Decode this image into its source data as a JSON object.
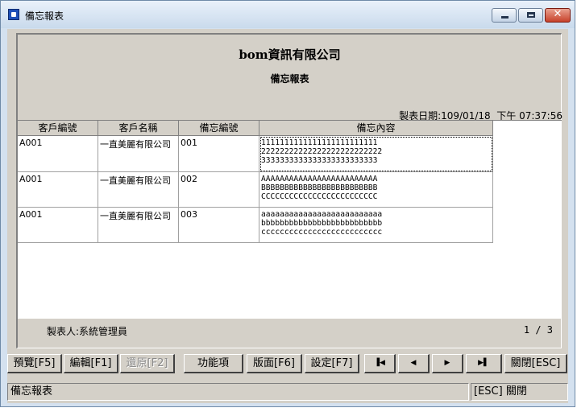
{
  "window": {
    "title": "備忘報表",
    "minimize_icon": "minimize-icon",
    "maximize_icon": "maximize-icon",
    "close_icon": "close-icon",
    "close_glyph": "✕"
  },
  "report": {
    "company": "bom資訊有限公司",
    "title": "備忘報表",
    "date_label": "製表日期:109/01/18",
    "time": "下午 07:37:56",
    "maker": "製表人:系統管理員",
    "page": "1 / 3"
  },
  "table": {
    "headers": [
      "客戶編號",
      "客戶名稱",
      "備忘編號",
      "備忘內容"
    ],
    "rows": [
      {
        "cust_id": "A001",
        "cust_name": "一直美麗有限公司",
        "memo_id": "001",
        "memo": [
          "1111111111111111111111111",
          "22222222222222222222222222",
          "3333333333333333333333333"
        ]
      },
      {
        "cust_id": "A001",
        "cust_name": "一直美麗有限公司",
        "memo_id": "002",
        "memo": [
          "AAAAAAAAAAAAAAAAAAAAAAAAA",
          "BBBBBBBBBBBBBBBBBBBBBBBBB",
          "CCCCCCCCCCCCCCCCCCCCCCCCC"
        ]
      },
      {
        "cust_id": "A001",
        "cust_name": "一直美麗有限公司",
        "memo_id": "003",
        "memo": [
          "aaaaaaaaaaaaaaaaaaaaaaaaaa",
          "bbbbbbbbbbbbbbbbbbbbbbbbbb",
          "cccccccccccccccccccccccccc"
        ]
      }
    ]
  },
  "toolbar": {
    "preview": "預覽[F5]",
    "edit": "編輯[F1]",
    "restore": "還原[F2]",
    "functions": "功能項",
    "layout": "版面[F6]",
    "settings": "設定[F7]",
    "first": "▐◀",
    "prev": "◀",
    "next": "▶",
    "last": "▶▌",
    "close": "關閉[ESC]"
  },
  "status": {
    "left": "備忘報表",
    "right": "[ESC] 關閉"
  }
}
